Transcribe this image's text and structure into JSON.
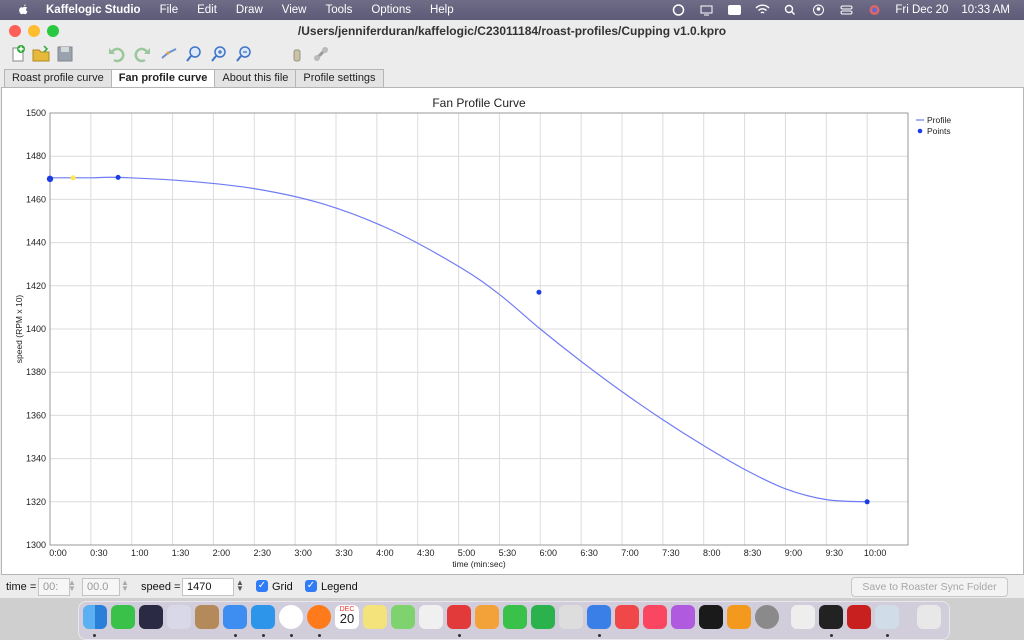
{
  "menubar": {
    "app_name": "Kaffelogic Studio",
    "items": [
      "File",
      "Edit",
      "Draw",
      "View",
      "Tools",
      "Options",
      "Help"
    ],
    "date": "Fri Dec 20",
    "time": "10:33 AM"
  },
  "window": {
    "title": "/Users/jenniferduran/kaffelogic/C23011184/roast-profiles/Cupping v1.0.kpro"
  },
  "tabs": [
    {
      "label": "Roast profile curve",
      "active": false
    },
    {
      "label": "Fan profile curve",
      "active": true
    },
    {
      "label": "About this file",
      "active": false
    },
    {
      "label": "Profile settings",
      "active": false
    }
  ],
  "chart_data": {
    "type": "line",
    "title": "Fan Profile Curve",
    "xlabel": "time (min:sec)",
    "ylabel": "speed (RPM x 10)",
    "xlim": [
      0,
      630
    ],
    "ylim": [
      1300,
      1500
    ],
    "x_ticks": [
      "0:00",
      "0:30",
      "1:00",
      "1:30",
      "2:00",
      "2:30",
      "3:00",
      "3:30",
      "4:00",
      "4:30",
      "5:00",
      "5:30",
      "6:00",
      "6:30",
      "7:00",
      "7:30",
      "8:00",
      "8:30",
      "9:00",
      "9:30",
      "10:00"
    ],
    "y_ticks": [
      1300,
      1320,
      1340,
      1360,
      1380,
      1400,
      1420,
      1440,
      1460,
      1480,
      1500
    ],
    "grid": true,
    "legend": "top-right",
    "series": [
      {
        "name": "Profile",
        "type": "line",
        "color": "#6f7cf5",
        "x": [
          0,
          30,
          50,
          100,
          150,
          200,
          250,
          300,
          330,
          360,
          390,
          420,
          450,
          480,
          510,
          540,
          570,
          600
        ],
        "y": [
          1470,
          1470,
          1470.2,
          1468.5,
          1465,
          1458,
          1446,
          1429,
          1416,
          1400,
          1385,
          1371,
          1358,
          1346,
          1335,
          1326,
          1321,
          1320
        ]
      },
      {
        "name": "Points",
        "type": "scatter",
        "color": "#1a3de6",
        "x": [
          0,
          50,
          359,
          600
        ],
        "y": [
          1469.5,
          1470.2,
          1417,
          1320
        ]
      }
    ],
    "highlight_point": {
      "x": 17,
      "y": 1470,
      "color": "#ffe84a"
    }
  },
  "status": {
    "time_label": "time =",
    "time_value": "00:",
    "time_fraction": "00.0",
    "speed_label": "speed =",
    "speed_value": "1470",
    "grid_label": "Grid",
    "legend_label": "Legend",
    "sync_button": "Save to Roaster Sync Folder"
  },
  "dock": {
    "calendar_month": "DEC",
    "calendar_day": "20"
  }
}
